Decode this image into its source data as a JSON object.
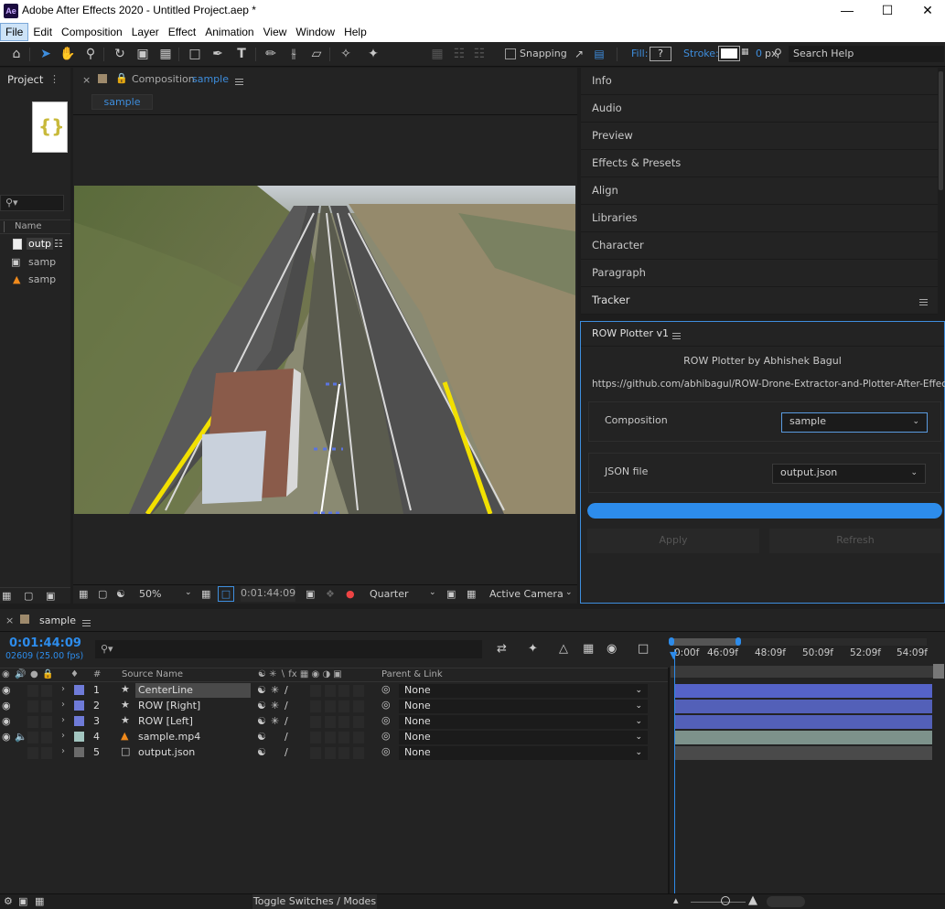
{
  "window": {
    "title": "Adobe After Effects 2020 - Untitled Project.aep *",
    "app_badge": "Ae"
  },
  "menu": [
    "File",
    "Edit",
    "Composition",
    "Layer",
    "Effect",
    "Animation",
    "View",
    "Window",
    "Help"
  ],
  "toolbar": {
    "snapping_label": "Snapping",
    "fill_label": "Fill:",
    "fill_value": "?",
    "stroke_label": "Stroke:",
    "stroke_px": "0",
    "px_unit": "px",
    "search_help": "Search Help"
  },
  "project": {
    "tab_label": "Project",
    "column_name": "Name",
    "items": [
      "outp",
      "samp",
      "samp"
    ]
  },
  "composition": {
    "tab_prefix": "Composition",
    "tab_name": "sample",
    "subtab": "sample",
    "zoom": "50%",
    "timecode": "0:01:44:09",
    "resolution": "Quarter",
    "camera": "Active Camera"
  },
  "right_panels": [
    "Info",
    "Audio",
    "Preview",
    "Effects & Presets",
    "Align",
    "Libraries",
    "Character",
    "Paragraph",
    "Tracker"
  ],
  "plugin": {
    "title": "ROW Plotter v1",
    "credit": "ROW Plotter by Abhishek Bagul",
    "url": "https://github.com/abhibagul/ROW-Drone-Extractor-and-Plotter-After-Effects",
    "composition_label": "Composition",
    "composition_value": "sample",
    "json_label": "JSON file",
    "json_value": "output.json",
    "progress": 1.0,
    "apply_label": "Apply",
    "refresh_label": "Refresh"
  },
  "timeline": {
    "tab_label": "sample",
    "timecode": "0:01:44:09",
    "frame_info": "02609 (25.00 fps)",
    "col_num": "#",
    "col_source": "Source Name",
    "col_parent": "Parent & Link",
    "ruler": [
      "0:00f",
      "46:09f",
      "48:09f",
      "50:09f",
      "52:09f",
      "54:09f"
    ],
    "layers": [
      {
        "num": "1",
        "name": "CenterLine",
        "parent": "None",
        "color": "#6f7bd8",
        "icon": "star"
      },
      {
        "num": "2",
        "name": "ROW [Right]",
        "parent": "None",
        "color": "#6f7bd8",
        "icon": "star"
      },
      {
        "num": "3",
        "name": "ROW [Left]",
        "parent": "None",
        "color": "#6f7bd8",
        "icon": "star"
      },
      {
        "num": "4",
        "name": "sample.mp4",
        "parent": "None",
        "color": "#a3c6c0",
        "icon": "cone"
      },
      {
        "num": "5",
        "name": "output.json",
        "parent": "None",
        "color": "#6b6b6b",
        "icon": "file"
      }
    ],
    "toggle_label": "Toggle Switches / Modes"
  },
  "colors": {
    "accent": "#2d8ceb",
    "bg": "#1d1d1d",
    "panel": "#232323"
  }
}
